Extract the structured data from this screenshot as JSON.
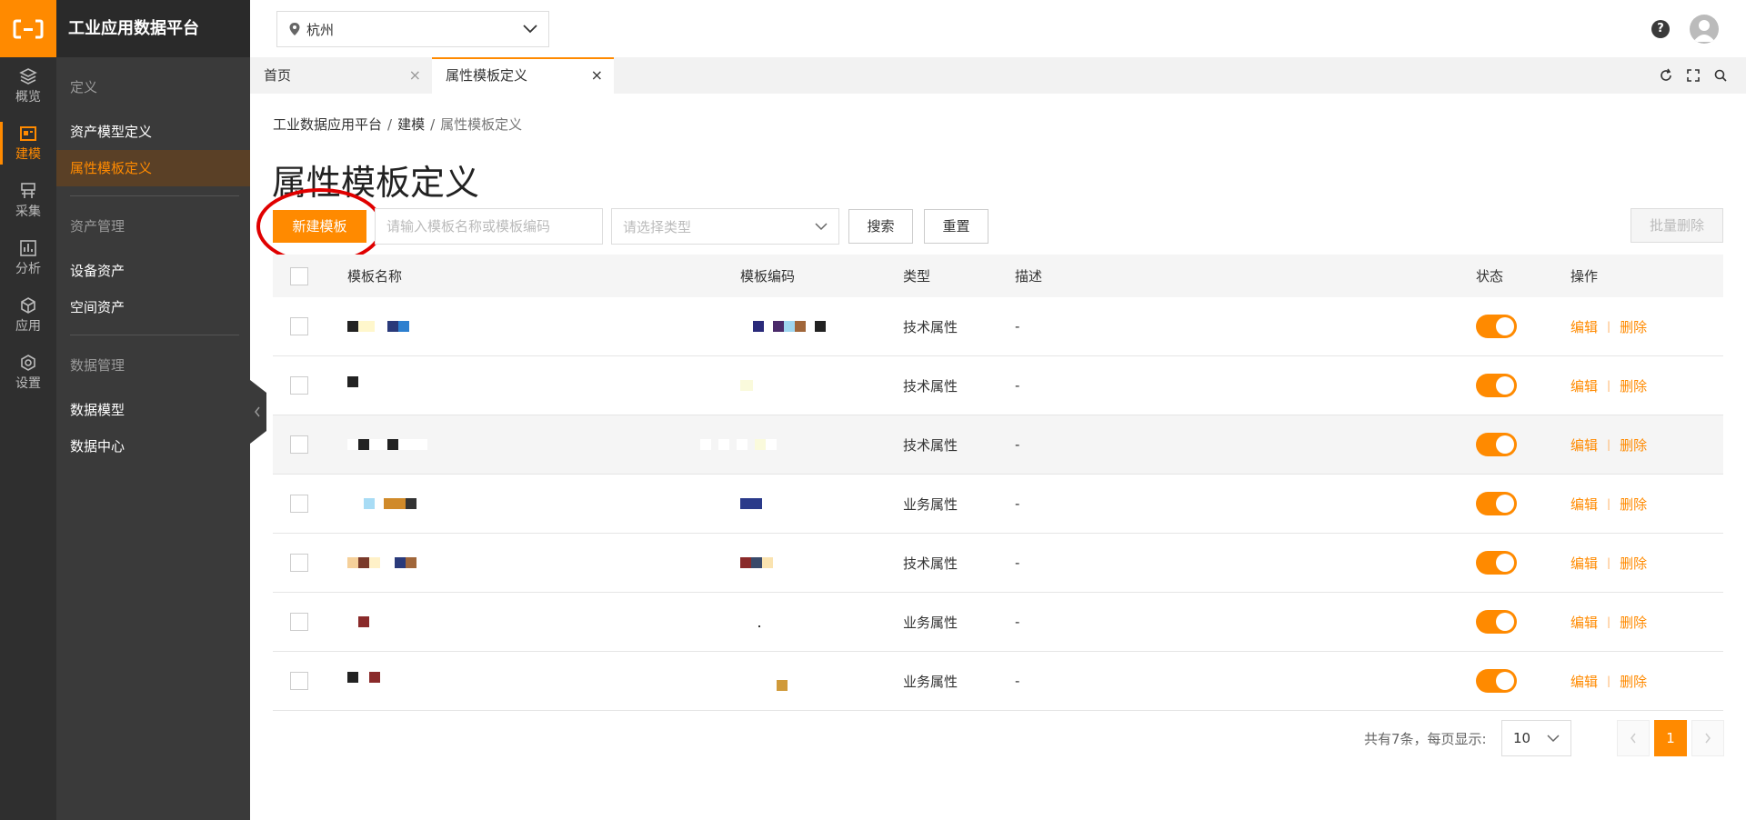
{
  "app": {
    "title": "工业应用数据平台"
  },
  "rail": [
    {
      "label": "概览",
      "icon": "layers-icon"
    },
    {
      "label": "建模",
      "icon": "model-icon",
      "active": true
    },
    {
      "label": "采集",
      "icon": "collect-icon"
    },
    {
      "label": "分析",
      "icon": "analysis-icon"
    },
    {
      "label": "应用",
      "icon": "cube-icon"
    },
    {
      "label": "设置",
      "icon": "settings-icon"
    }
  ],
  "sidebar": {
    "groups": [
      {
        "title": "定义",
        "items": [
          "资产模型定义",
          "属性模板定义"
        ]
      },
      {
        "title": "资产管理",
        "items": [
          "设备资产",
          "空间资产"
        ]
      },
      {
        "title": "数据管理",
        "items": [
          "数据模型",
          "数据中心"
        ]
      }
    ]
  },
  "topbar": {
    "city": "杭州",
    "help": "?"
  },
  "tabs": [
    {
      "label": "首页"
    },
    {
      "label": "属性模板定义"
    }
  ],
  "breadcrumb": [
    "工业数据应用平台",
    "建模",
    "属性模板定义"
  ],
  "page_title": "属性模板定义",
  "toolbar": {
    "new_label": "新建模板",
    "search_placeholder": "请输入模板名称或模板编码",
    "type_placeholder": "请选择类型",
    "search_label": "搜索",
    "reset_label": "重置",
    "batch_delete_label": "批量删除"
  },
  "table": {
    "columns": [
      "模板名称",
      "模板编码",
      "类型",
      "描述",
      "状态",
      "操作"
    ],
    "rows": [
      {
        "type": "技术属性",
        "desc": "-",
        "edit": "编辑",
        "delete": "删除"
      },
      {
        "type": "技术属性",
        "desc": "-",
        "edit": "编辑",
        "delete": "删除"
      },
      {
        "type": "技术属性",
        "desc": "-",
        "edit": "编辑",
        "delete": "删除"
      },
      {
        "type": "业务属性",
        "desc": "-",
        "edit": "编辑",
        "delete": "删除"
      },
      {
        "type": "技术属性",
        "desc": "-",
        "edit": "编辑",
        "delete": "删除"
      },
      {
        "type": "业务属性",
        "desc": "-",
        "edit": "编辑",
        "delete": "删除"
      },
      {
        "type": "业务属性",
        "desc": "-",
        "edit": "编辑",
        "delete": "删除"
      }
    ]
  },
  "pagination": {
    "total_text": "共有7条，每页显示:",
    "page_size": "10",
    "current": "1"
  },
  "colors": {
    "accent": "#ff8a00",
    "rail_bg": "#2f2f2f",
    "sidebar_bg": "#3a3a3a"
  }
}
